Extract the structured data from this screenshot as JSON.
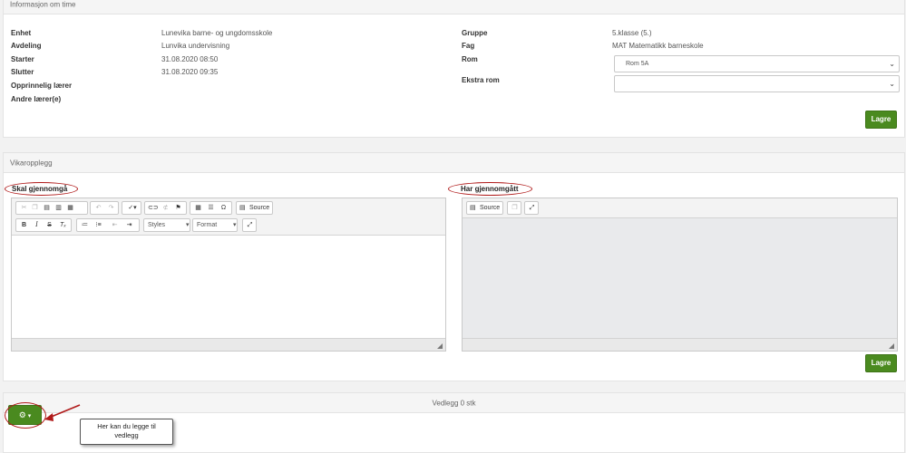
{
  "info_panel": {
    "title": "Informasjon om time",
    "left": [
      {
        "label": "Enhet",
        "value": "Lunevika barne- og ungdomsskole"
      },
      {
        "label": "Avdeling",
        "value": "Lunvika undervisning"
      },
      {
        "label": "Starter",
        "value": "31.08.2020 08:50"
      },
      {
        "label": "Slutter",
        "value": "31.08.2020 09:35"
      },
      {
        "label": "Opprinnelig lærer",
        "value": ""
      },
      {
        "label": "Andre lærer(e)",
        "value": ""
      }
    ],
    "right": [
      {
        "label": "Gruppe",
        "value": "5.klasse (5.)"
      },
      {
        "label": "Fag",
        "value": "MAT Matematikk barneskole"
      },
      {
        "label": "Rom",
        "value": "Rom 5A"
      },
      {
        "label": "Ekstra rom",
        "value": ""
      }
    ],
    "save_label": "Lagre"
  },
  "vikar_panel": {
    "title": "Vikaropplegg",
    "left_editor_title": "Skal gjennomgå",
    "right_editor_title": "Har gjennomgått",
    "styles_label": "Styles",
    "format_label": "Format",
    "source_label": "Source",
    "save_label": "Lagre"
  },
  "attachments_panel": {
    "title": "Vedlegg 0 stk",
    "callout_text": "Her kan du legge til vedlegg"
  },
  "colors": {
    "accent_green": "#4a8a1f",
    "annotation_red": "#b01a1a"
  }
}
